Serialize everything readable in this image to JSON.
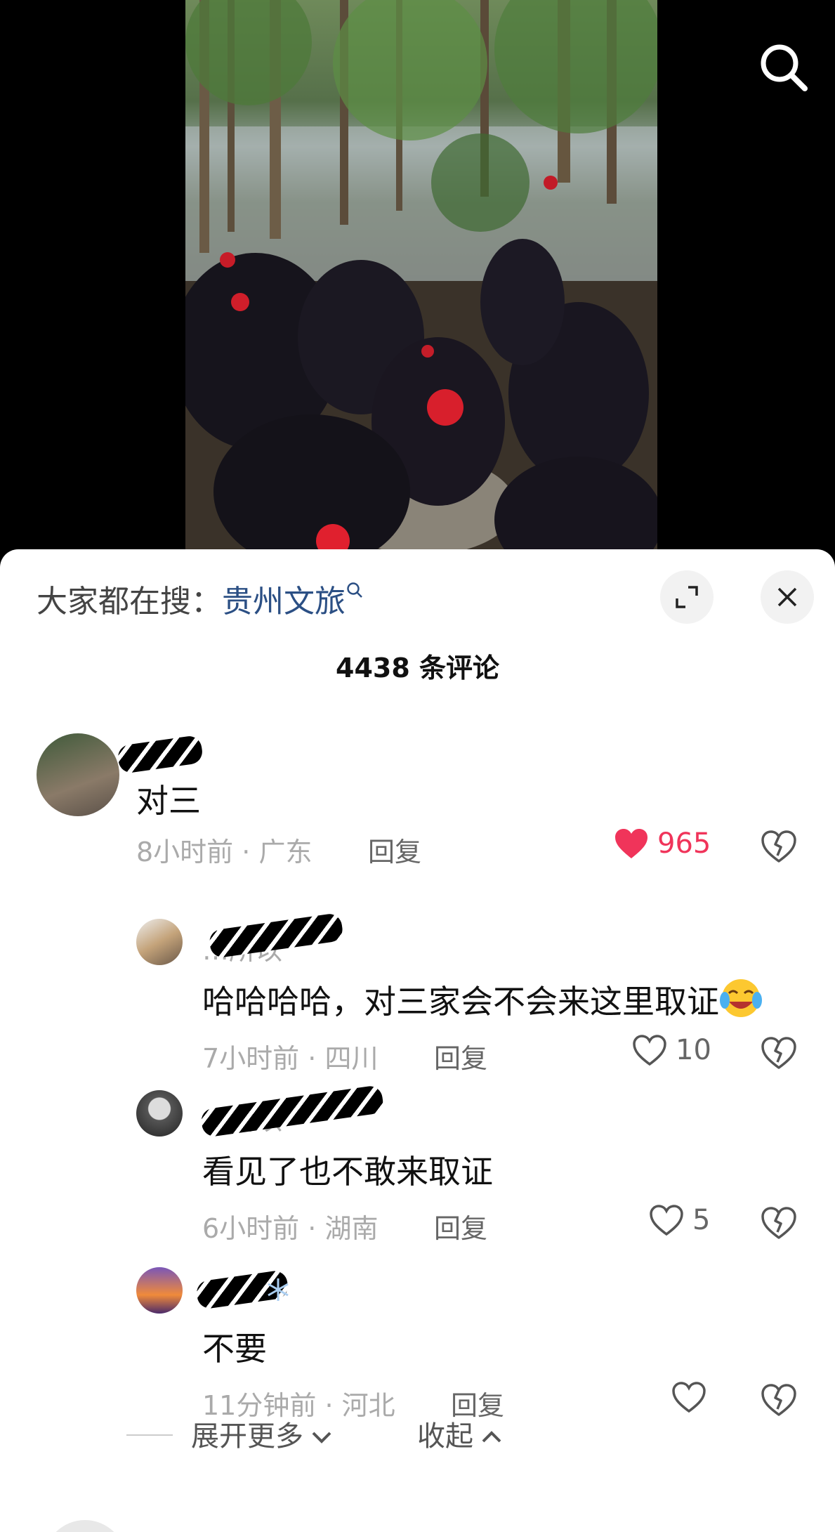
{
  "search_suggest": {
    "prefix": "大家都在搜：",
    "term": "贵州文旅"
  },
  "comment_count": "4438 条评论",
  "comments": [
    {
      "text": "对三",
      "time": "8小时前",
      "location": "广东",
      "reply": "回复",
      "likes": "965",
      "liked": true
    },
    {
      "username_visible": "…所以",
      "text": "哈哈哈哈，对三家会不会来这里取证",
      "time": "7小时前",
      "location": "四川",
      "reply": "回复",
      "likes": "10",
      "liked": false
    },
    {
      "username_visible": "…所以",
      "text": "看见了也不敢来取证",
      "time": "6小时前",
      "location": "湖南",
      "reply": "回复",
      "likes": "5",
      "liked": false
    },
    {
      "text": "不要",
      "time": "11分钟前",
      "location": "河北",
      "reply": "回复",
      "likes": "",
      "liked": false
    }
  ],
  "meta_separator": " · ",
  "expand_more": "展开更多",
  "collapse": "收起",
  "colors": {
    "like_red": "#f0345a",
    "search_term": "#2b4f84"
  },
  "icons": [
    "search-icon",
    "expand-icon",
    "close-icon",
    "heart-icon",
    "broken-heart-icon",
    "chevron-down-icon",
    "chevron-up-icon"
  ]
}
